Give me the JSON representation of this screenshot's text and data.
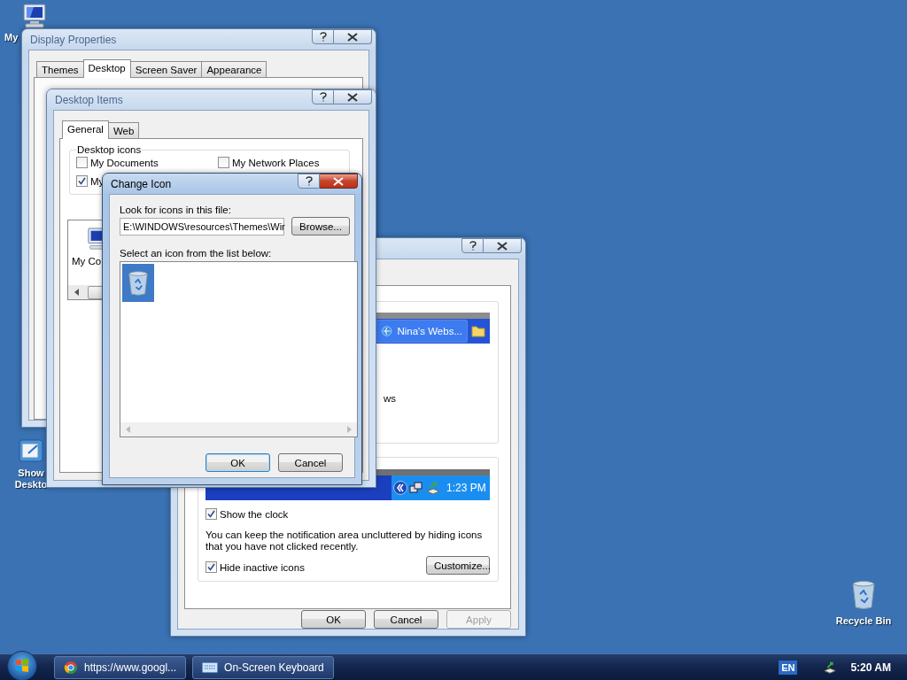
{
  "desktop_icons": [
    {
      "kind": "computer",
      "label": "My"
    },
    {
      "kind": "show-desktop",
      "label": "Show Deskto"
    },
    {
      "kind": "recycle-bin",
      "label": "Recycle Bin"
    }
  ],
  "display_properties": {
    "title": "Display Properties",
    "active": false,
    "tabs": [
      {
        "label": "Themes",
        "selected": false
      },
      {
        "label": "Desktop",
        "selected": true
      },
      {
        "label": "Screen Saver",
        "selected": false
      },
      {
        "label": "Appearance",
        "selected": false
      }
    ]
  },
  "taskbar_properties": {
    "active": false,
    "preview_button": "Nina's Webs...",
    "fragment": "ws",
    "tray_time": "1:23 PM",
    "show_clock": {
      "label": "Show the clock",
      "checked": true
    },
    "note": "You can keep the notification area uncluttered by hiding icons that you have not clicked recently.",
    "hide_inactive": {
      "label": "Hide inactive icons",
      "checked": true
    },
    "customize": "Customize...",
    "buttons": [
      {
        "label": "OK",
        "disabled": false
      },
      {
        "label": "Cancel",
        "disabled": false
      },
      {
        "label": "Apply",
        "disabled": true
      }
    ]
  },
  "desktop_items": {
    "title": "Desktop Items",
    "active": false,
    "tabs": [
      {
        "label": "General",
        "selected": true
      },
      {
        "label": "Web",
        "selected": false
      }
    ],
    "group_title": "Desktop icons",
    "checkboxes": [
      {
        "label": "My Documents",
        "checked": false
      },
      {
        "label": "My Network Places",
        "checked": false
      },
      {
        "label": "My",
        "checked": true
      }
    ],
    "list_items": [
      {
        "label": "My Co"
      }
    ]
  },
  "change_icon": {
    "title": "Change Icon",
    "active": true,
    "file_label": "Look for icons in this file:",
    "file_value": "E:\\WINDOWS\\resources\\Themes\\Wir",
    "browse": "Browse...",
    "list_label": "Select an icon from the list below:",
    "icons": [
      {
        "kind": "recycle-bin",
        "selected": true
      }
    ],
    "buttons": [
      {
        "label": "OK",
        "default": true
      },
      {
        "label": "Cancel",
        "default": false
      }
    ]
  },
  "taskbar": {
    "tasks": [
      {
        "kind": "browser",
        "label": "https://www.googl..."
      },
      {
        "kind": "keyboard",
        "label": "On-Screen Keyboard"
      }
    ],
    "language": "EN",
    "clock": "5:20 AM"
  }
}
